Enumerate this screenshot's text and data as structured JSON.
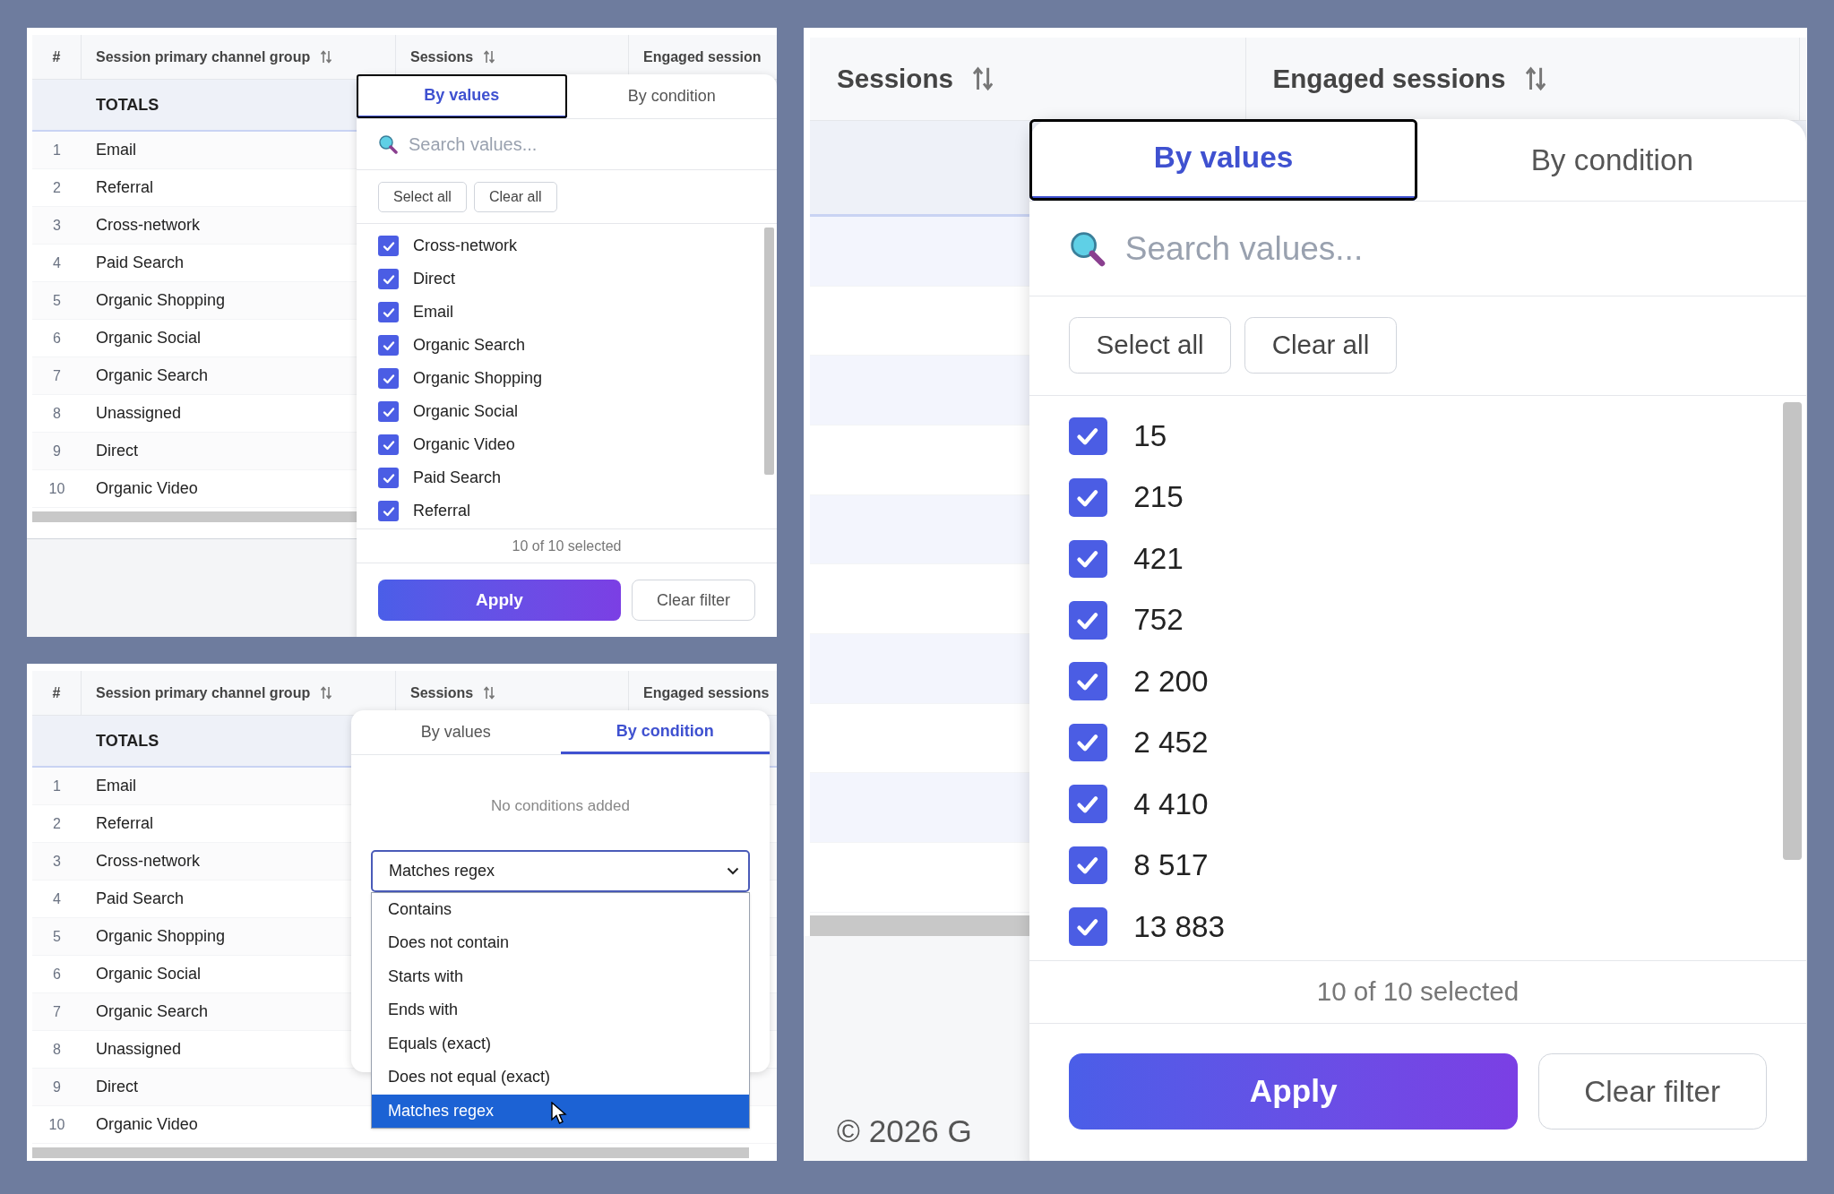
{
  "panels": [
    {
      "kind": "table_values",
      "table": {
        "columns": [
          {
            "label": "#",
            "sortable": false
          },
          {
            "label": "Session primary channel group",
            "sortable": true
          },
          {
            "label": "Sessions",
            "sortable": true
          },
          {
            "label": "Engaged session"
          }
        ],
        "totals_label": "TOTALS",
        "rows": [
          {
            "index": "1",
            "channel": "Email"
          },
          {
            "index": "2",
            "channel": "Referral"
          },
          {
            "index": "3",
            "channel": "Cross-network"
          },
          {
            "index": "4",
            "channel": "Paid Search"
          },
          {
            "index": "5",
            "channel": "Organic Shopping"
          },
          {
            "index": "6",
            "channel": "Organic Social"
          },
          {
            "index": "7",
            "channel": "Organic Search"
          },
          {
            "index": "8",
            "channel": "Unassigned"
          },
          {
            "index": "9",
            "channel": "Direct"
          },
          {
            "index": "10",
            "channel": "Organic Video"
          }
        ]
      },
      "filter": {
        "kind": "values",
        "tabs": [
          {
            "label": "By values",
            "selected": true,
            "focused": true
          },
          {
            "label": "By condition",
            "selected": false,
            "focused": false
          }
        ],
        "search": {
          "placeholder": "Search values..."
        },
        "actions": [
          "Select all",
          "Clear all"
        ],
        "values": [
          {
            "label": "Cross-network",
            "checked": true
          },
          {
            "label": "Direct",
            "checked": true
          },
          {
            "label": "Email",
            "checked": true
          },
          {
            "label": "Organic Search",
            "checked": true
          },
          {
            "label": "Organic Shopping",
            "checked": true
          },
          {
            "label": "Organic Social",
            "checked": true
          },
          {
            "label": "Organic Video",
            "checked": true
          },
          {
            "label": "Paid Search",
            "checked": true
          },
          {
            "label": "Referral",
            "checked": true
          }
        ],
        "summary": "10 of 10 selected",
        "apply": "Apply",
        "clear_filter": "Clear filter"
      }
    },
    {
      "kind": "table_condition",
      "table": {
        "columns": [
          {
            "label": "#",
            "sortable": false
          },
          {
            "label": "Session primary channel group",
            "sortable": true
          },
          {
            "label": "Sessions",
            "sortable": true
          },
          {
            "label": "Engaged sessions"
          }
        ],
        "totals_label": "TOTALS",
        "rows": [
          {
            "index": "1",
            "channel": "Email"
          },
          {
            "index": "2",
            "channel": "Referral"
          },
          {
            "index": "3",
            "channel": "Cross-network"
          },
          {
            "index": "4",
            "channel": "Paid Search"
          },
          {
            "index": "5",
            "channel": "Organic Shopping"
          },
          {
            "index": "6",
            "channel": "Organic Social"
          },
          {
            "index": "7",
            "channel": "Organic Search"
          },
          {
            "index": "8",
            "channel": "Unassigned"
          },
          {
            "index": "9",
            "channel": "Direct"
          },
          {
            "index": "10",
            "channel": "Organic Video"
          }
        ]
      },
      "filter": {
        "kind": "condition",
        "tabs": [
          {
            "label": "By values",
            "selected": false,
            "focused": false
          },
          {
            "label": "By condition",
            "selected": true,
            "focused": false
          }
        ],
        "empty_message": "No conditions added",
        "operator": {
          "value": "Matches regex",
          "options": [
            {
              "label": "Contains",
              "selected": false
            },
            {
              "label": "Does not contain",
              "selected": false
            },
            {
              "label": "Starts with",
              "selected": false
            },
            {
              "label": "Ends with",
              "selected": false
            },
            {
              "label": "Equals (exact)",
              "selected": false
            },
            {
              "label": "Does not equal (exact)",
              "selected": false
            },
            {
              "label": "Matches regex",
              "selected": true
            }
          ]
        }
      }
    },
    {
      "kind": "zoomed_values",
      "table": {
        "columns": [
          {
            "label": "Sessions",
            "sortable": true
          },
          {
            "label": "Engaged sessions",
            "sortable": true
          }
        ]
      },
      "footer": "© 2026 G",
      "filter": {
        "kind": "values",
        "tabs": [
          {
            "label": "By values",
            "selected": true,
            "focused": true
          },
          {
            "label": "By condition",
            "selected": false,
            "focused": false
          }
        ],
        "search": {
          "placeholder": "Search values..."
        },
        "actions": [
          "Select all",
          "Clear all"
        ],
        "values": [
          {
            "label": "15",
            "checked": true
          },
          {
            "label": "215",
            "checked": true
          },
          {
            "label": "421",
            "checked": true
          },
          {
            "label": "752",
            "checked": true
          },
          {
            "label": "2 200",
            "checked": true
          },
          {
            "label": "2 452",
            "checked": true
          },
          {
            "label": "4 410",
            "checked": true
          },
          {
            "label": "8 517",
            "checked": true
          },
          {
            "label": "13 883",
            "checked": true
          }
        ],
        "summary": "10 of 10 selected",
        "apply": "Apply",
        "clear_filter": "Clear filter"
      }
    }
  ]
}
